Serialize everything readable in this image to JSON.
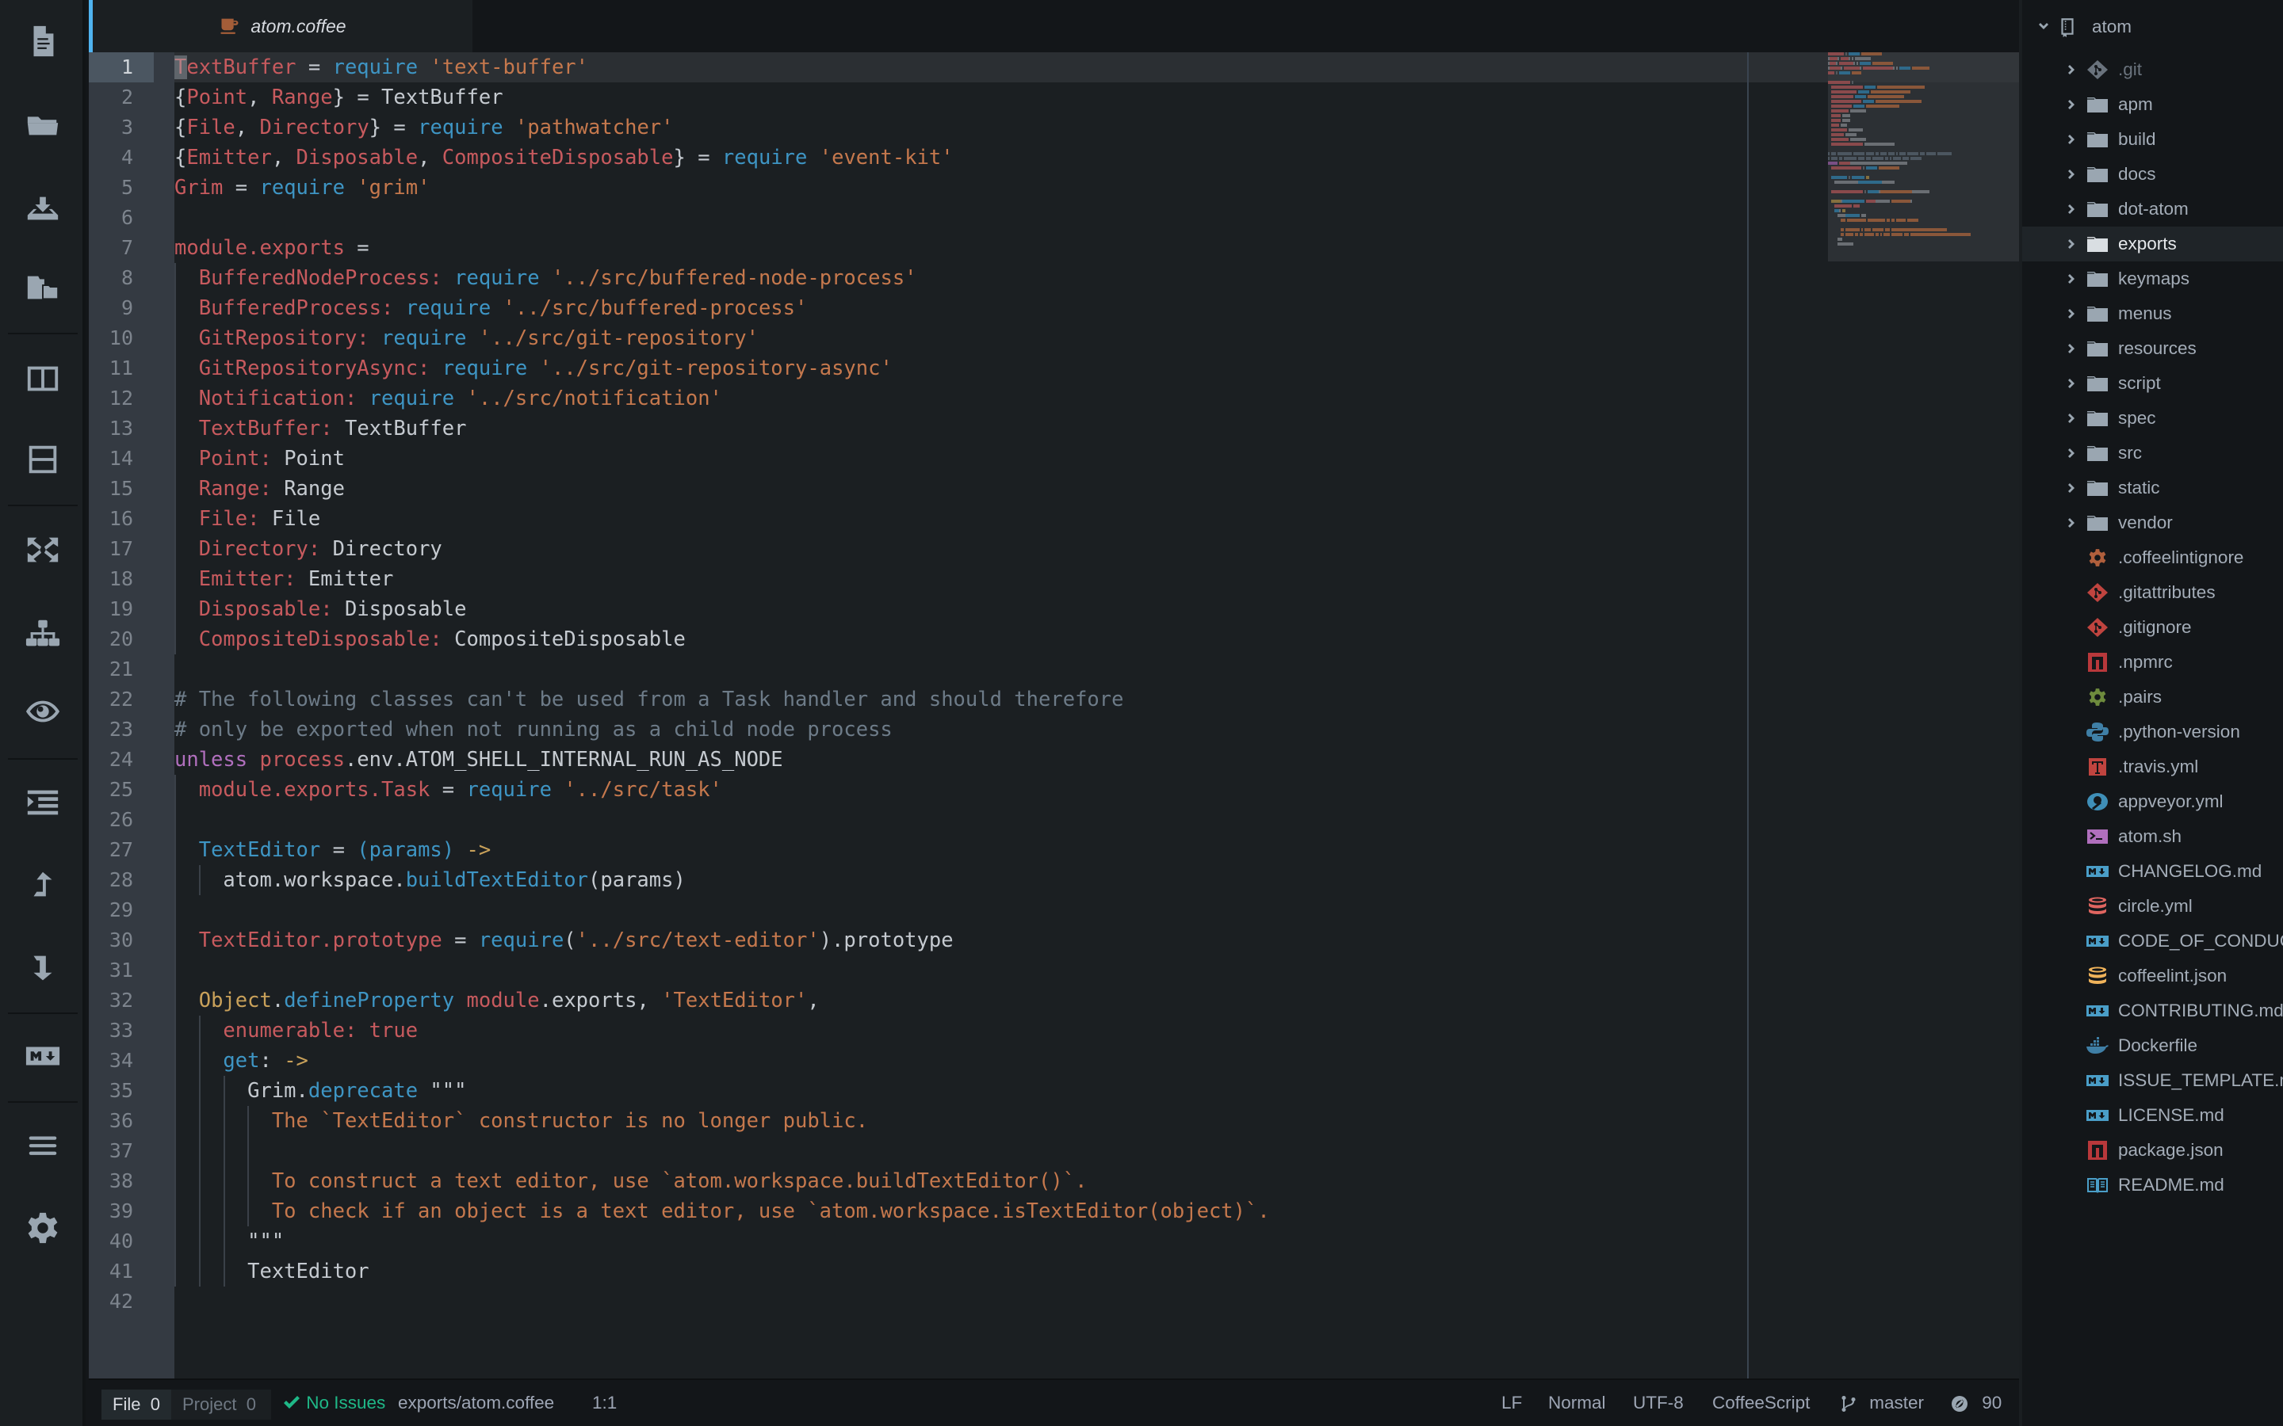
{
  "toolbar": {
    "buttons": [
      {
        "name": "new-file",
        "icon": "new-file-icon"
      },
      {
        "name": "open-folder",
        "icon": "folder-open-icon"
      },
      {
        "name": "save",
        "icon": "download-icon"
      },
      {
        "name": "open-project",
        "icon": "project-folder-icon"
      },
      {
        "name": "split-vertical",
        "icon": "split-vertical-icon"
      },
      {
        "name": "split-horizontal",
        "icon": "split-horizontal-icon"
      },
      {
        "name": "fullscreen",
        "icon": "expand-icon"
      },
      {
        "name": "tree-view",
        "icon": "sitemap-icon"
      },
      {
        "name": "preview",
        "icon": "eye-icon"
      },
      {
        "name": "indent",
        "icon": "indent-list-icon"
      },
      {
        "name": "move-up",
        "icon": "arrow-up-icon"
      },
      {
        "name": "move-down",
        "icon": "arrow-down-icon"
      },
      {
        "name": "markdown-preview",
        "icon": "markdown-icon"
      },
      {
        "name": "command-palette",
        "icon": "hamburger-icon"
      },
      {
        "name": "settings",
        "icon": "gear-icon"
      }
    ]
  },
  "tabs": [
    {
      "title": "atom.coffee",
      "icon": "coffee-icon",
      "active": true
    }
  ],
  "editor": {
    "language": "CoffeeScript",
    "cursor_line": 1,
    "lines": [
      [
        [
          "t-var",
          "TextBuffer"
        ],
        [
          "t-op",
          " = "
        ],
        [
          "t-kw",
          "require"
        ],
        [
          "t-op",
          " "
        ],
        [
          "t-str",
          "'text-buffer'"
        ]
      ],
      [
        [
          "t-pl",
          "{"
        ],
        [
          "t-var",
          "Point"
        ],
        [
          "t-pl",
          ", "
        ],
        [
          "t-var",
          "Range"
        ],
        [
          "t-pl",
          "} = TextBuffer"
        ]
      ],
      [
        [
          "t-pl",
          "{"
        ],
        [
          "t-var",
          "File"
        ],
        [
          "t-pl",
          ", "
        ],
        [
          "t-var",
          "Directory"
        ],
        [
          "t-pl",
          "} = "
        ],
        [
          "t-kw",
          "require"
        ],
        [
          "t-op",
          " "
        ],
        [
          "t-str",
          "'pathwatcher'"
        ]
      ],
      [
        [
          "t-pl",
          "{"
        ],
        [
          "t-var",
          "Emitter"
        ],
        [
          "t-pl",
          ", "
        ],
        [
          "t-var",
          "Disposable"
        ],
        [
          "t-pl",
          ", "
        ],
        [
          "t-var",
          "CompositeDisposable"
        ],
        [
          "t-pl",
          "} = "
        ],
        [
          "t-kw",
          "require"
        ],
        [
          "t-op",
          " "
        ],
        [
          "t-str",
          "'event-kit'"
        ]
      ],
      [
        [
          "t-var",
          "Grim"
        ],
        [
          "t-op",
          " = "
        ],
        [
          "t-kw",
          "require"
        ],
        [
          "t-op",
          " "
        ],
        [
          "t-str",
          "'grim'"
        ]
      ],
      [],
      [
        [
          "t-var",
          "module.exports"
        ],
        [
          "t-op",
          " ="
        ]
      ],
      [
        [
          "t-pl",
          "  "
        ],
        [
          "t-var",
          "BufferedNodeProcess:"
        ],
        [
          "t-op",
          " "
        ],
        [
          "t-kw",
          "require"
        ],
        [
          "t-op",
          " "
        ],
        [
          "t-str",
          "'../src/buffered-node-process'"
        ]
      ],
      [
        [
          "t-pl",
          "  "
        ],
        [
          "t-var",
          "BufferedProcess:"
        ],
        [
          "t-op",
          " "
        ],
        [
          "t-kw",
          "require"
        ],
        [
          "t-op",
          " "
        ],
        [
          "t-str",
          "'../src/buffered-process'"
        ]
      ],
      [
        [
          "t-pl",
          "  "
        ],
        [
          "t-var",
          "GitRepository:"
        ],
        [
          "t-op",
          " "
        ],
        [
          "t-kw",
          "require"
        ],
        [
          "t-op",
          " "
        ],
        [
          "t-str",
          "'../src/git-repository'"
        ]
      ],
      [
        [
          "t-pl",
          "  "
        ],
        [
          "t-var",
          "GitRepositoryAsync:"
        ],
        [
          "t-op",
          " "
        ],
        [
          "t-kw",
          "require"
        ],
        [
          "t-op",
          " "
        ],
        [
          "t-str",
          "'../src/git-repository-async'"
        ]
      ],
      [
        [
          "t-pl",
          "  "
        ],
        [
          "t-var",
          "Notification:"
        ],
        [
          "t-op",
          " "
        ],
        [
          "t-kw",
          "require"
        ],
        [
          "t-op",
          " "
        ],
        [
          "t-str",
          "'../src/notification'"
        ]
      ],
      [
        [
          "t-pl",
          "  "
        ],
        [
          "t-var",
          "TextBuffer:"
        ],
        [
          "t-pl",
          " TextBuffer"
        ]
      ],
      [
        [
          "t-pl",
          "  "
        ],
        [
          "t-var",
          "Point:"
        ],
        [
          "t-pl",
          " Point"
        ]
      ],
      [
        [
          "t-pl",
          "  "
        ],
        [
          "t-var",
          "Range:"
        ],
        [
          "t-pl",
          " Range"
        ]
      ],
      [
        [
          "t-pl",
          "  "
        ],
        [
          "t-var",
          "File:"
        ],
        [
          "t-pl",
          " File"
        ]
      ],
      [
        [
          "t-pl",
          "  "
        ],
        [
          "t-var",
          "Directory:"
        ],
        [
          "t-pl",
          " Directory"
        ]
      ],
      [
        [
          "t-pl",
          "  "
        ],
        [
          "t-var",
          "Emitter:"
        ],
        [
          "t-pl",
          " Emitter"
        ]
      ],
      [
        [
          "t-pl",
          "  "
        ],
        [
          "t-var",
          "Disposable:"
        ],
        [
          "t-pl",
          " Disposable"
        ]
      ],
      [
        [
          "t-pl",
          "  "
        ],
        [
          "t-var",
          "CompositeDisposable:"
        ],
        [
          "t-pl",
          " CompositeDisposable"
        ]
      ],
      [],
      [
        [
          "t-cm",
          "# The following classes can't be used from a Task handler and should therefore"
        ]
      ],
      [
        [
          "t-cm",
          "# only be exported when not running as a child node process"
        ]
      ],
      [
        [
          "t-pu",
          "unless"
        ],
        [
          "t-op",
          " "
        ],
        [
          "t-var",
          "process"
        ],
        [
          "t-pl",
          ".env.ATOM_SHELL_INTERNAL_RUN_AS_NODE"
        ]
      ],
      [
        [
          "t-pl",
          "  "
        ],
        [
          "t-var",
          "module.exports.Task"
        ],
        [
          "t-op",
          " = "
        ],
        [
          "t-kw",
          "require"
        ],
        [
          "t-op",
          " "
        ],
        [
          "t-str",
          "'../src/task'"
        ]
      ],
      [],
      [
        [
          "t-pl",
          "  "
        ],
        [
          "t-kw",
          "TextEditor"
        ],
        [
          "t-op",
          " = "
        ],
        [
          "t-kw",
          "(params)"
        ],
        [
          "t-op",
          " "
        ],
        [
          "t-cls",
          "->"
        ]
      ],
      [
        [
          "t-pl",
          "    atom.workspace."
        ],
        [
          "t-kw",
          "buildTextEditor"
        ],
        [
          "t-pl",
          "(params)"
        ]
      ],
      [],
      [
        [
          "t-pl",
          "  "
        ],
        [
          "t-var",
          "TextEditor.prototype"
        ],
        [
          "t-op",
          " = "
        ],
        [
          "t-kw",
          "require"
        ],
        [
          "t-pl",
          "("
        ],
        [
          "t-str",
          "'../src/text-editor'"
        ],
        [
          "t-pl",
          ").prototype"
        ]
      ],
      [],
      [
        [
          "t-pl",
          "  "
        ],
        [
          "t-cls",
          "Object"
        ],
        [
          "t-pl",
          "."
        ],
        [
          "t-kw",
          "defineProperty"
        ],
        [
          "t-op",
          " "
        ],
        [
          "t-var",
          "module"
        ],
        [
          "t-pl",
          ".exports, "
        ],
        [
          "t-str",
          "'TextEditor'"
        ],
        [
          "t-pl",
          ","
        ]
      ],
      [
        [
          "t-pl",
          "    "
        ],
        [
          "t-var",
          "enumerable: true"
        ]
      ],
      [
        [
          "t-pl",
          "    "
        ],
        [
          "t-kw",
          "get"
        ],
        [
          "t-pl",
          ": "
        ],
        [
          "t-cls",
          "->"
        ]
      ],
      [
        [
          "t-pl",
          "      Grim."
        ],
        [
          "t-kw",
          "deprecate"
        ],
        [
          "t-pl",
          " \"\"\""
        ]
      ],
      [
        [
          "t-pl",
          "        "
        ],
        [
          "t-str",
          "The `TextEditor` constructor is no longer public."
        ]
      ],
      [],
      [
        [
          "t-pl",
          "        "
        ],
        [
          "t-str",
          "To construct a text editor, use `atom.workspace.buildTextEditor()`."
        ]
      ],
      [
        [
          "t-pl",
          "        "
        ],
        [
          "t-str",
          "To check if an object is a text editor, use `atom.workspace.isTextEditor(object)`."
        ]
      ],
      [
        [
          "t-pl",
          "      \"\"\""
        ]
      ],
      [
        [
          "t-pl",
          "      TextEditor"
        ]
      ],
      []
    ]
  },
  "tree": {
    "root": {
      "label": "atom",
      "icon": "repo-book-icon",
      "expanded": true
    },
    "items": [
      {
        "label": ".git",
        "type": "dir",
        "icon": "git-icon",
        "color": "#6a737d",
        "dim": true
      },
      {
        "label": "apm",
        "type": "dir",
        "icon": "folder-icon",
        "color": "#9aa6b1"
      },
      {
        "label": "build",
        "type": "dir",
        "icon": "folder-icon",
        "color": "#9aa6b1"
      },
      {
        "label": "docs",
        "type": "dir",
        "icon": "folder-icon",
        "color": "#9aa6b1"
      },
      {
        "label": "dot-atom",
        "type": "dir",
        "icon": "folder-icon",
        "color": "#9aa6b1"
      },
      {
        "label": "exports",
        "type": "dir",
        "icon": "folder-icon",
        "color": "#d9dee2",
        "selected": true
      },
      {
        "label": "keymaps",
        "type": "dir",
        "icon": "folder-icon",
        "color": "#9aa6b1"
      },
      {
        "label": "menus",
        "type": "dir",
        "icon": "folder-icon",
        "color": "#9aa6b1"
      },
      {
        "label": "resources",
        "type": "dir",
        "icon": "folder-icon",
        "color": "#9aa6b1"
      },
      {
        "label": "script",
        "type": "dir",
        "icon": "folder-icon",
        "color": "#9aa6b1"
      },
      {
        "label": "spec",
        "type": "dir",
        "icon": "folder-icon",
        "color": "#9aa6b1"
      },
      {
        "label": "src",
        "type": "dir",
        "icon": "folder-icon",
        "color": "#9aa6b1"
      },
      {
        "label": "static",
        "type": "dir",
        "icon": "folder-icon",
        "color": "#9aa6b1"
      },
      {
        "label": "vendor",
        "type": "dir",
        "icon": "folder-icon",
        "color": "#9aa6b1"
      },
      {
        "label": ".coffeelintignore",
        "type": "file",
        "icon": "gear-icon",
        "color": "#b05f3c"
      },
      {
        "label": ".gitattributes",
        "type": "file",
        "icon": "git-icon",
        "color": "#c0443f"
      },
      {
        "label": ".gitignore",
        "type": "file",
        "icon": "git-icon",
        "color": "#c0443f"
      },
      {
        "label": ".npmrc",
        "type": "file",
        "icon": "npm-icon",
        "color": "#b8383b"
      },
      {
        "label": ".pairs",
        "type": "file",
        "icon": "gear-icon",
        "color": "#6e8b3d"
      },
      {
        "label": ".python-version",
        "type": "file",
        "icon": "python-icon",
        "color": "#3f7fa6"
      },
      {
        "label": ".travis.yml",
        "type": "file",
        "icon": "travis-icon",
        "color": "#c0443f"
      },
      {
        "label": "appveyor.yml",
        "type": "file",
        "icon": "appveyor-icon",
        "color": "#3f8fb8"
      },
      {
        "label": "atom.sh",
        "type": "file",
        "icon": "terminal-icon",
        "color": "#b06fbd"
      },
      {
        "label": "CHANGELOG.md",
        "type": "file",
        "icon": "markdown-icon",
        "color": "#4a9ec8"
      },
      {
        "label": "circle.yml",
        "type": "file",
        "icon": "database-icon",
        "color": "#e06560"
      },
      {
        "label": "CODE_OF_CONDUCT.md",
        "type": "file",
        "icon": "markdown-icon",
        "color": "#4a9ec8"
      },
      {
        "label": "coffeelint.json",
        "type": "file",
        "icon": "database-icon",
        "color": "#f0b35a"
      },
      {
        "label": "CONTRIBUTING.md",
        "type": "file",
        "icon": "markdown-icon",
        "color": "#4a9ec8"
      },
      {
        "label": "Dockerfile",
        "type": "file",
        "icon": "docker-icon",
        "color": "#3f7fa6"
      },
      {
        "label": "ISSUE_TEMPLATE.md",
        "type": "file",
        "icon": "markdown-icon",
        "color": "#4a9ec8"
      },
      {
        "label": "LICENSE.md",
        "type": "file",
        "icon": "markdown-icon",
        "color": "#4a9ec8"
      },
      {
        "label": "package.json",
        "type": "file",
        "icon": "npm-icon",
        "color": "#b8383b"
      },
      {
        "label": "README.md",
        "type": "file",
        "icon": "book-icon",
        "color": "#4a9ec8"
      }
    ]
  },
  "statusbar": {
    "file_tab": "File",
    "file_count": "0",
    "project_tab": "Project",
    "project_count": "0",
    "lint_status": "No Issues",
    "path": "exports/atom.coffee",
    "cursor_position": "1:1",
    "line_ending": "LF",
    "mode": "Normal",
    "encoding": "UTF-8",
    "grammar": "CoffeeScript",
    "branch": "master",
    "issues_count": "90"
  },
  "colors": {
    "accent": "#4fb3f0",
    "lint_ok": "#1fb887"
  }
}
